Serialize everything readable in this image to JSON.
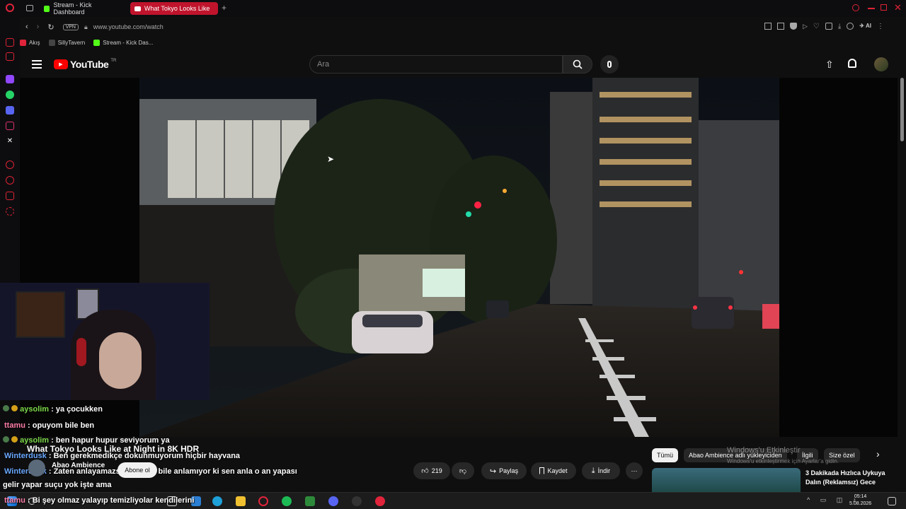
{
  "browser": {
    "tabs": [
      {
        "label": "Stream - Kick Dashboard"
      },
      {
        "label": "What Tokyo Looks Like"
      }
    ],
    "vpn_label": "VPN",
    "url": "www.youtube.com/watch",
    "ai_label": "AI",
    "bookmarks": [
      {
        "label": "Akış"
      },
      {
        "label": "SillyTavern"
      },
      {
        "label": "Stream - Kick Das..."
      }
    ]
  },
  "youtube": {
    "logo_text": "YouTube",
    "region": "TR",
    "search_placeholder": "Ara"
  },
  "video": {
    "title": "What Tokyo Looks Like at Night in 8K HDR",
    "channel": "Abao Ambience",
    "subscribe_label": "Abone ol",
    "like_count": "219",
    "share_label": "Paylaş",
    "save_label": "Kaydet",
    "download_label": "İndir"
  },
  "chips": [
    {
      "label": "Tümü"
    },
    {
      "label": "Abao Ambience adlı yükleyiciden"
    },
    {
      "label": "İlgili"
    },
    {
      "label": "Size özel"
    }
  ],
  "recommended": {
    "title_line1": "3 Dakikada Hızlıca Uykuya",
    "title_line2": "Dalın (Reklamsız) Gece"
  },
  "watermark": {
    "line1": "Windows'u Etkinleştir",
    "line2": "Windows'u etkinleştirmek için Ayarlar'a gidin."
  },
  "chat": [
    {
      "user": "aysolim",
      "message": ": ya çocukken",
      "color": "#7ddb4b",
      "badge": true
    },
    {
      "user": "ttamu",
      "message": ": opuyom bile ben",
      "color": "#ff7ea8",
      "badge": false
    },
    {
      "user": "aysolim",
      "message": ": ben hapur hupur seviyorum ya",
      "color": "#7ddb4b",
      "badge": true
    },
    {
      "user": "Winterdusk",
      "message": ": Ben gerekmedikçe dokunmuyorum hiçbir hayvana",
      "color": "#6aa8ff",
      "badge": false
    },
    {
      "user": "Winterdusk",
      "message": ": Zaten anlayamazsın hayvan bile anlamıyor ki sen anla o an yapası",
      "color": "#6aa8ff",
      "badge": false
    },
    {
      "user": "",
      "message": "gelir yapar suçu yok işte ama",
      "color": "#ffffff",
      "badge": false
    },
    {
      "user": "ttamu",
      "message": ": Bi şey olmaz yalayıp temizliyolar kendilerini",
      "color": "#ff7ea8",
      "badge": false
    }
  ],
  "taskbar": {
    "time": "05:14",
    "date": "5.08.2026"
  }
}
